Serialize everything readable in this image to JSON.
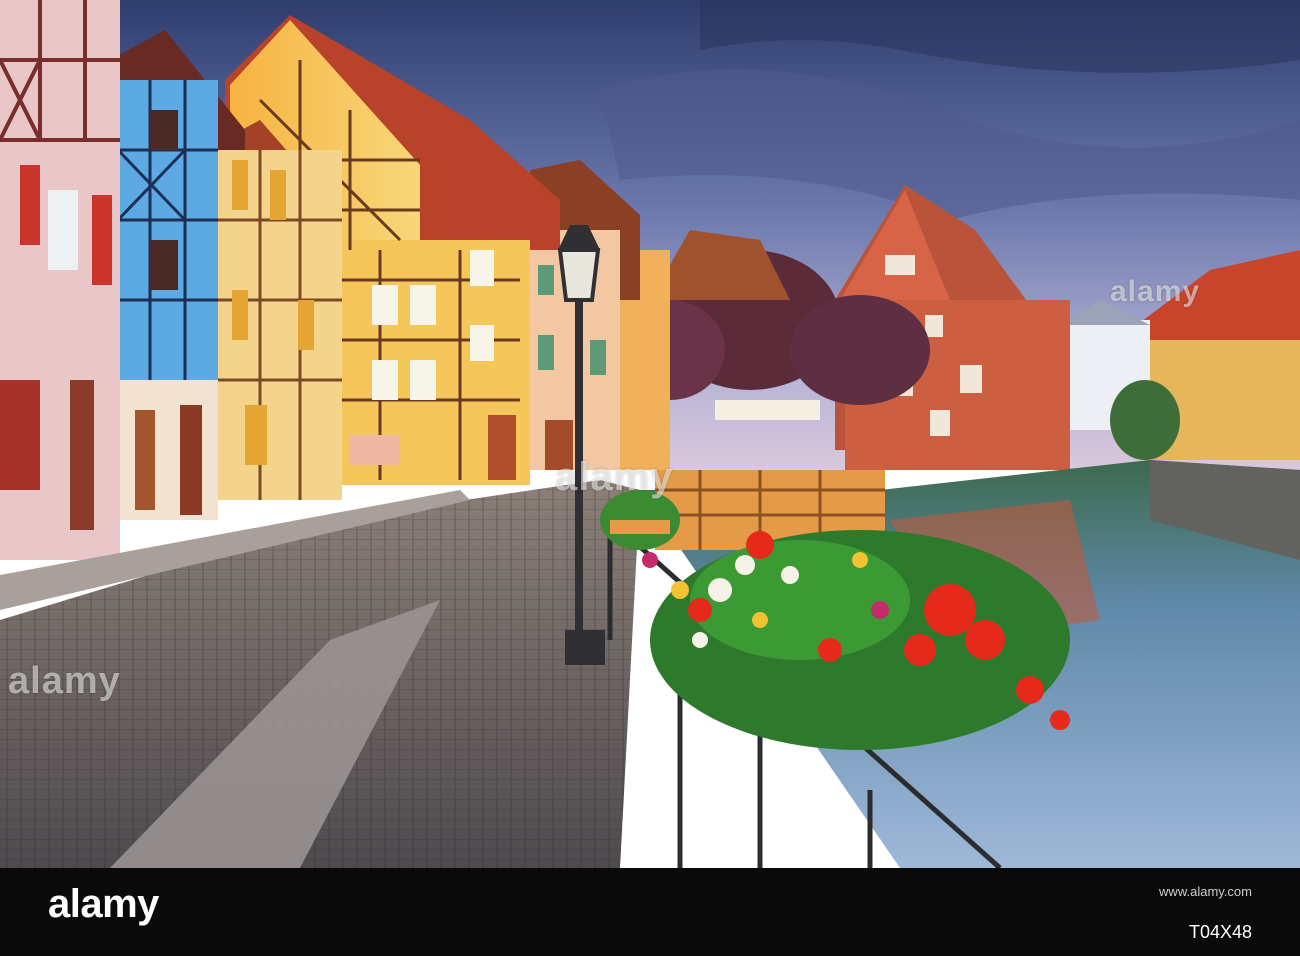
{
  "watermark": {
    "center_text": "alamy",
    "left_text": "alamy",
    "right_text": "alamy"
  },
  "footer": {
    "logo_text": "alamy",
    "image_id": "T04X48",
    "url": "www.alamy.com"
  },
  "colors": {
    "footer_background": "#0a0a0a",
    "sky": "#5b6c9c",
    "canal_water": "#6f8fb8"
  }
}
